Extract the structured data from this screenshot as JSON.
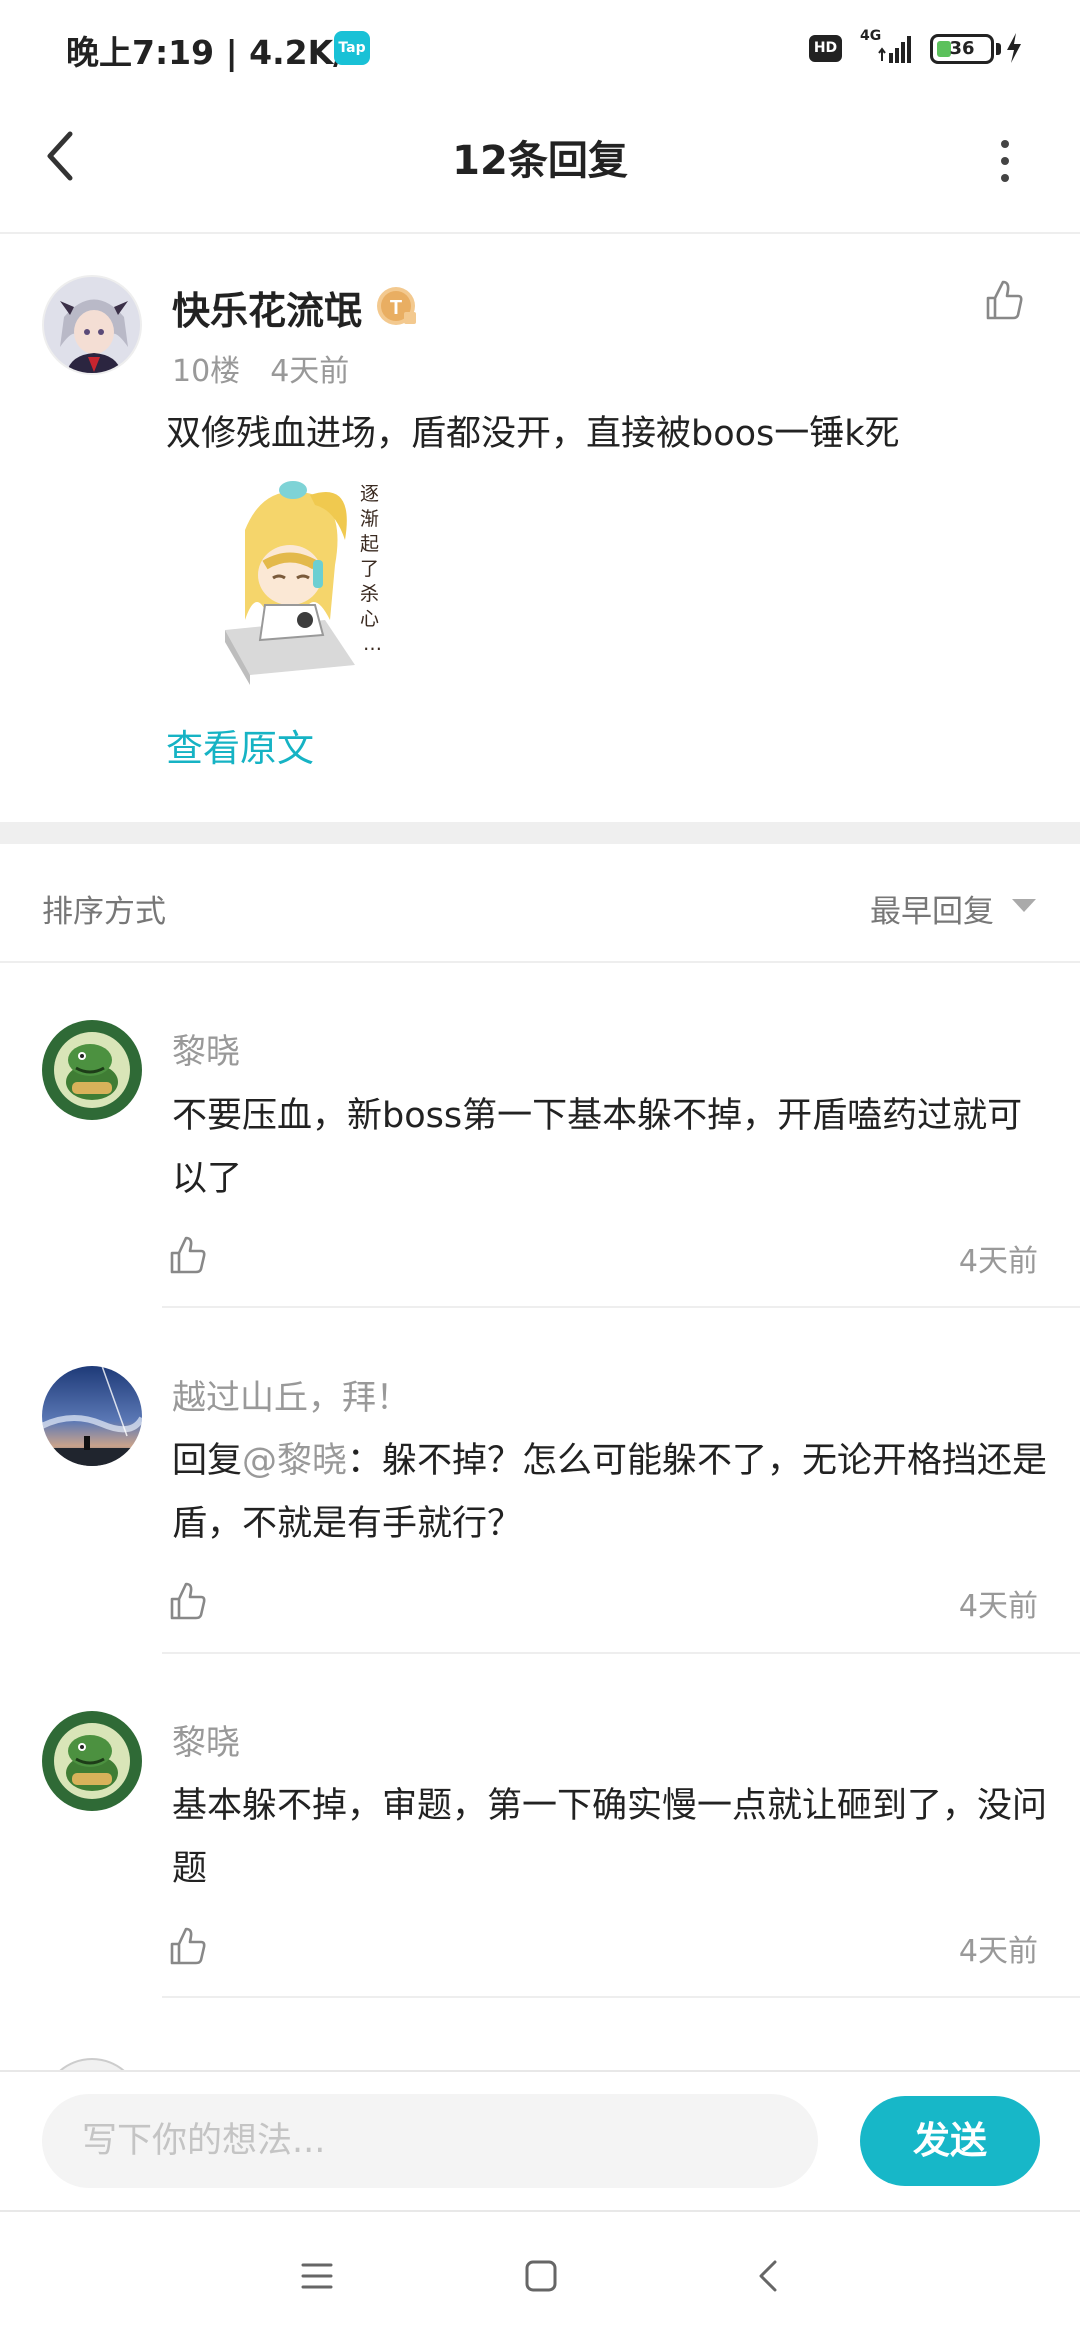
{
  "status_bar": {
    "time": "晚上7:19 | 4.2K/s",
    "tap_badge": "Tap",
    "hd": "HD",
    "network": "4G",
    "battery": "36"
  },
  "header": {
    "title": "12条回复"
  },
  "post": {
    "author": "快乐花流氓",
    "level_badge": "T",
    "floor": "10楼",
    "time": "4天前",
    "text": "双修残血进场，盾都没开，直接被boos一锤k死",
    "sticker_caption": "逐渐起了杀心…",
    "view_original": "查看原文"
  },
  "sort": {
    "label": "排序方式",
    "selected": "最早回复"
  },
  "replies": [
    {
      "name": "黎晓",
      "text": "不要压血，新boss第一下基本躲不掉，开盾嗑药过就可以了",
      "time": "4天前"
    },
    {
      "name": "越过山丘，拜！",
      "reply_prefix": "回复",
      "mention": "@黎晓",
      "text": "：躲不掉？怎么可能躲不了，无论开格挡还是盾，不就是有手就行？",
      "time": "4天前"
    },
    {
      "name": "黎晓",
      "text": "基本躲不掉，审题，第一下确实慢一点就让砸到了，没问题",
      "time": "4天前"
    }
  ],
  "composer": {
    "placeholder": "写下你的想法...",
    "send_label": "发送"
  },
  "colors": {
    "accent": "#17b7c8",
    "text_primary": "#222222",
    "text_secondary": "#999999"
  }
}
